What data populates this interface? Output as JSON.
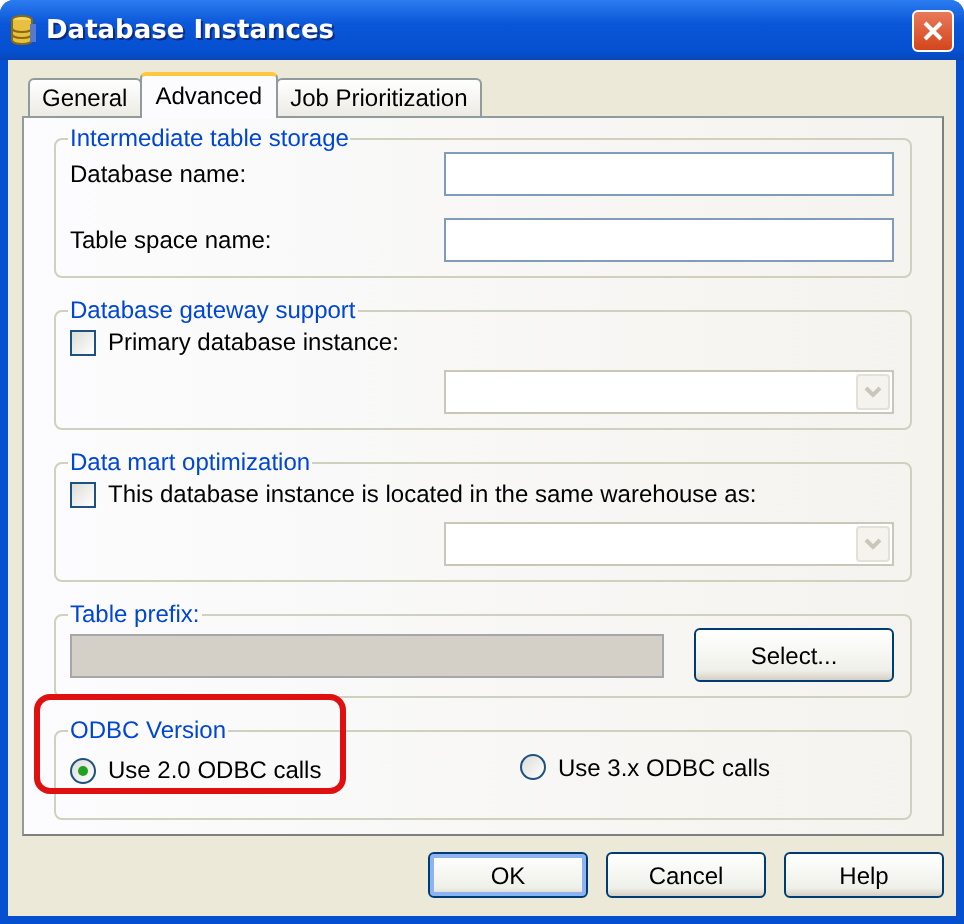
{
  "window": {
    "title": "Database Instances"
  },
  "tabs": [
    {
      "label": "General",
      "selected": false
    },
    {
      "label": "Advanced",
      "selected": true
    },
    {
      "label": "Job Prioritization",
      "selected": false
    }
  ],
  "groups": [
    {
      "kind": "fields",
      "title": "Intermediate table storage",
      "fields": [
        {
          "label": "Database name:"
        },
        {
          "label": "Table space name:"
        }
      ]
    },
    {
      "kind": "checkbox_combo",
      "title": "Database gateway support",
      "checkbox": {
        "label": "Primary database instance:",
        "checked": false
      },
      "combo": {
        "disabled": true
      }
    },
    {
      "kind": "checkbox_combo",
      "title": "Data mart optimization",
      "checkbox": {
        "label": "This database instance is located in the same warehouse as:",
        "checked": false
      },
      "combo": {
        "disabled": true
      }
    },
    {
      "kind": "prefix",
      "title": "Table prefix:",
      "field": {
        "disabled": true
      },
      "button": "Select..."
    },
    {
      "kind": "radios",
      "title": "ODBC Version",
      "highlighted": true,
      "options": [
        {
          "label": "Use 2.0 ODBC calls",
          "selected": true
        },
        {
          "label": "Use 3.x ODBC calls",
          "selected": false
        }
      ]
    }
  ],
  "buttons": [
    {
      "label": "OK",
      "default": true
    },
    {
      "label": "Cancel",
      "default": false
    },
    {
      "label": "Help",
      "default": false
    }
  ]
}
